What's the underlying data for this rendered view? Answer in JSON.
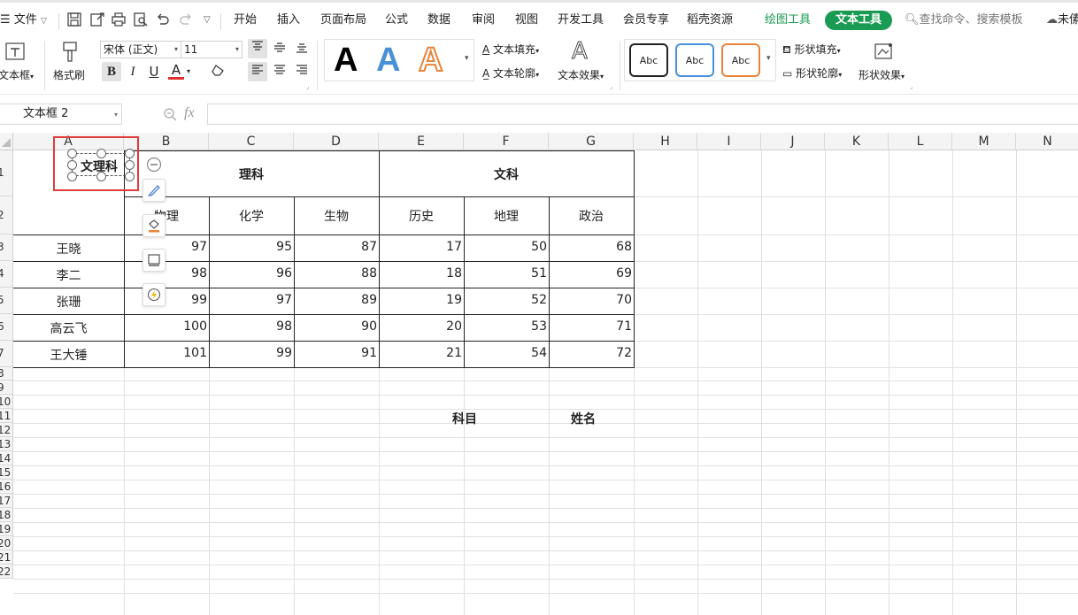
{
  "menu": {
    "file": "文件",
    "tabs": [
      "开始",
      "插入",
      "页面布局",
      "公式",
      "数据",
      "审阅",
      "视图",
      "开发工具",
      "会员专享",
      "稻壳资源"
    ],
    "drawing_tools": "绘图工具",
    "text_tools": "文本工具",
    "search": "查找命令、搜索模板",
    "cloud_status": "未傃"
  },
  "ribbon": {
    "textbox": "文本框",
    "format_painter": "格式刷",
    "font_name": "宋体 (正文)",
    "font_size": "11",
    "bold": "B",
    "italic": "I",
    "underline": "U",
    "font_color": "A",
    "text_fill": "文本填充",
    "text_outline": "文本轮廓",
    "text_effect": "文本效果",
    "shape_fill": "形状填充",
    "shape_outline": "形状轮廓",
    "shape_effect": "形状效果",
    "style_letter": "A",
    "shape_styles": [
      "Abc",
      "Abc",
      "Abc"
    ],
    "colors": {
      "accent_blue": "#4a90d9",
      "accent_orange": "#e8843a",
      "accent_green": "#1a9b53",
      "font_red": "#e03030"
    }
  },
  "formula_bar": {
    "name_box": "文本框 2",
    "fx": "fx",
    "value": ""
  },
  "sheet": {
    "columns": [
      "A",
      "B",
      "C",
      "D",
      "E",
      "F",
      "G",
      "H",
      "I",
      "J",
      "K",
      "L",
      "M",
      "N"
    ],
    "row_numbers": [
      "1",
      "2",
      "3",
      "4",
      "5",
      "6",
      "7",
      "8",
      "9",
      "10",
      "11",
      "12",
      "13",
      "14",
      "15",
      "16",
      "17",
      "18",
      "19",
      "20",
      "21",
      "22"
    ],
    "textbox_text": "文理科",
    "group_science": "理科",
    "group_arts": "文科",
    "subjects": [
      "物理",
      "化学",
      "生物",
      "历史",
      "地理",
      "政治"
    ],
    "students": [
      {
        "name": "王晓",
        "scores": [
          "97",
          "95",
          "87",
          "17",
          "50",
          "68"
        ]
      },
      {
        "name": "李二",
        "scores": [
          "98",
          "96",
          "88",
          "18",
          "51",
          "69"
        ]
      },
      {
        "name": "张珊",
        "scores": [
          "99",
          "97",
          "89",
          "19",
          "52",
          "70"
        ]
      },
      {
        "name": "高云飞",
        "scores": [
          "100",
          "98",
          "90",
          "20",
          "53",
          "71"
        ]
      },
      {
        "name": "王大锤",
        "scores": [
          "101",
          "99",
          "91",
          "21",
          "54",
          "72"
        ]
      }
    ],
    "label_subject": "科目",
    "label_name": "姓名"
  }
}
